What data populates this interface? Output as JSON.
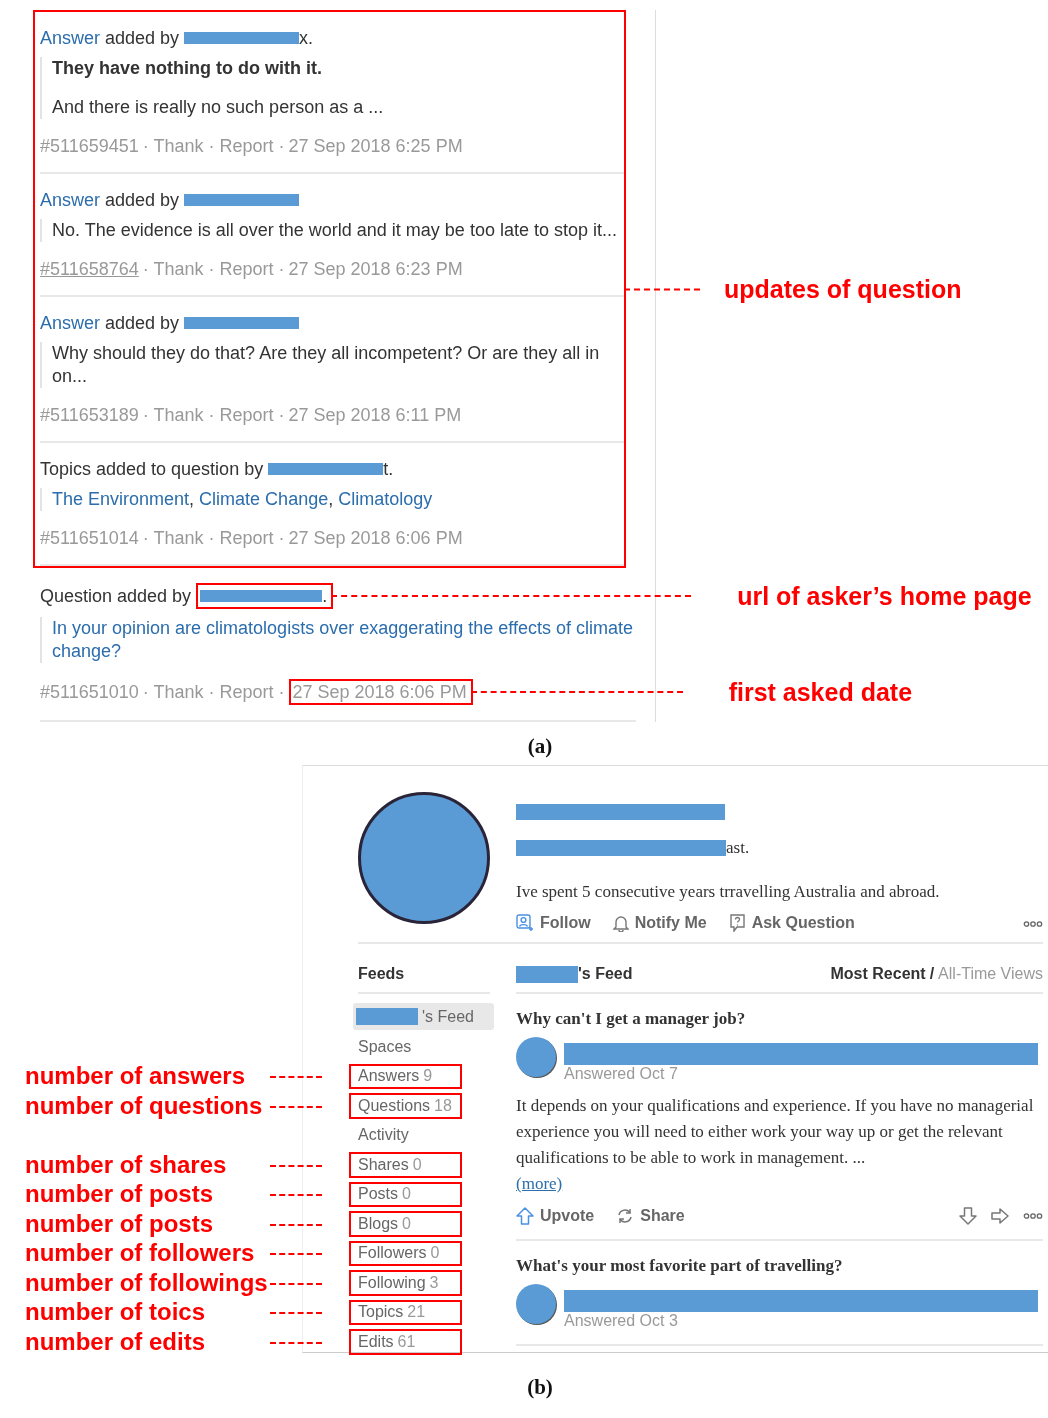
{
  "figure_a": {
    "highlight_annotation": "updates of question",
    "caption": "(a)",
    "entries": [
      {
        "kind": "answer",
        "lead_link": "Answer",
        "lead": "added by",
        "author_suffix": "x.",
        "highlighted": true,
        "body": [
          {
            "text": "They have nothing to do with it.",
            "bold": true
          },
          {
            "text": "And there is really no such person as a ...",
            "bold": false
          }
        ],
        "id": "#511659451",
        "id_underlined": false,
        "actions": "· Thank · Report ·",
        "date": "27 Sep 2018 6:25 PM"
      },
      {
        "kind": "answer",
        "lead_link": "Answer",
        "lead": "added by",
        "highlighted": true,
        "body": [
          {
            "text": "No. The evidence is all over the world and it may be too late to stop it...",
            "bold": false
          }
        ],
        "id": "#511658764",
        "id_underlined": true,
        "actions": "· Thank · Report ·",
        "date": "27 Sep 2018 6:23 PM"
      },
      {
        "kind": "answer",
        "lead_link": "Answer",
        "lead": "added by",
        "highlighted": true,
        "body": [
          {
            "text": "Why should they do that? Are they all incompetent? Or are they all in on...",
            "bold": false
          }
        ],
        "id": "#511653189",
        "id_underlined": false,
        "actions": "· Thank · Report ·",
        "date": "27 Sep 2018 6:11 PM"
      },
      {
        "kind": "topics",
        "lead": "Topics added to question by",
        "author_suffix": "t.",
        "highlighted": true,
        "topics": [
          "The Environment",
          "Climate Change",
          "Climatology"
        ],
        "topic_separator": ",",
        "id": "#511651014",
        "id_underlined": false,
        "actions": "· Thank · Report ·",
        "date": "27 Sep 2018 6:06 PM"
      },
      {
        "kind": "question",
        "lead": "Question added by",
        "author_suffix": ".",
        "author_boxed": true,
        "author_annotation": "url of asker’s home page",
        "highlighted": false,
        "question": "In your opinion are climatologists over exaggerating the effects of climate change?",
        "id": "#511651010",
        "id_underlined": false,
        "actions": "· Thank · Report ·",
        "date": "27 Sep 2018 6:06 PM",
        "date_boxed": true,
        "date_annotation": "first asked date"
      }
    ]
  },
  "figure_b": {
    "caption": "(b)",
    "profile": {
      "tagline_suffix": "ast.",
      "bio": "Ive spent 5 consecutive years trravelling Australia and abroad.",
      "actions": [
        {
          "kind": "follow",
          "label": "Follow"
        },
        {
          "kind": "notify",
          "label": "Notify Me"
        },
        {
          "kind": "ask",
          "label": "Ask Question"
        }
      ]
    },
    "sidebar": {
      "title": "Feeds",
      "items": [
        {
          "label": "'s Feed",
          "redacted_prefix": true,
          "selected": true,
          "boxed": false
        },
        {
          "label": "Spaces",
          "selected": false,
          "boxed": false
        },
        {
          "label": "Answers",
          "count": "9",
          "selected": false,
          "boxed": true,
          "annotation": "number of answers"
        },
        {
          "label": "Questions",
          "count": "18",
          "selected": false,
          "boxed": true,
          "annotation": "number of questions"
        },
        {
          "label": "Activity",
          "selected": false,
          "boxed": false
        },
        {
          "label": "Shares",
          "count": "0",
          "selected": false,
          "boxed": true,
          "annotation": "number of shares"
        },
        {
          "label": "Posts",
          "count": "0",
          "selected": false,
          "boxed": true,
          "annotation": "number of posts"
        },
        {
          "label": "Blogs",
          "count": "0",
          "selected": false,
          "boxed": true,
          "annotation": "number of posts"
        },
        {
          "label": "Followers",
          "count": "0",
          "selected": false,
          "boxed": true,
          "annotation": "number of followers"
        },
        {
          "label": "Following",
          "count": "3",
          "selected": false,
          "boxed": true,
          "annotation": "number of followings"
        },
        {
          "label": "Topics",
          "count": "21",
          "selected": false,
          "boxed": true,
          "annotation": "number of toics"
        },
        {
          "label": "Edits",
          "count": "61",
          "selected": false,
          "boxed": true,
          "annotation": "number of edits"
        }
      ]
    },
    "feed": {
      "owner_suffix": "'s Feed",
      "sort_separator": "/",
      "sort": [
        {
          "label": "Most Recent",
          "selected": true
        },
        {
          "label": "All-Time Views",
          "selected": false
        }
      ],
      "items": [
        {
          "title": "Why can't I get a manager job?",
          "answered": "Answered Oct 7",
          "body": "It depends on your qualifications and experience. If you have no managerial experience you will need to either work your way up or get the relevant qualifications to be able to work in management. ...",
          "more": "(more)",
          "actions": [
            {
              "kind": "upvote",
              "label": "Upvote"
            },
            {
              "kind": "share",
              "label": "Share"
            }
          ]
        },
        {
          "title": "What's your most favorite part of travelling?",
          "answered": "Answered Oct 3"
        }
      ]
    }
  }
}
